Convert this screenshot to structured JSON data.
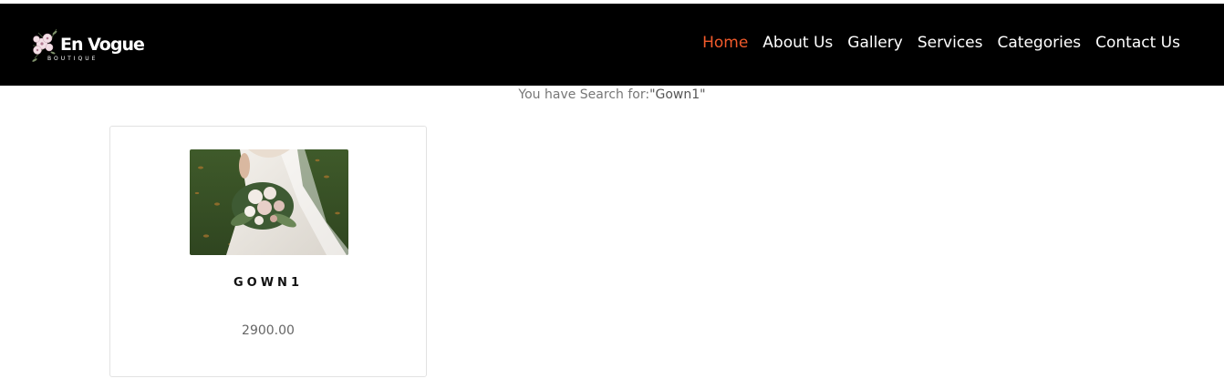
{
  "brand": {
    "name": "En Vogue",
    "tagline": "BOUTIQUE"
  },
  "nav": {
    "items": [
      {
        "label": "Home",
        "active": true
      },
      {
        "label": "About Us",
        "active": false
      },
      {
        "label": "Gallery",
        "active": false
      },
      {
        "label": "Services",
        "active": false
      },
      {
        "label": "Categories",
        "active": false
      },
      {
        "label": "Contact Us",
        "active": false
      }
    ]
  },
  "search": {
    "prefix": "You have Search for:",
    "query": "\"Gown1\""
  },
  "results": [
    {
      "title": "GOWN1",
      "price": "2900.00",
      "image": "bride-bouquet-photo"
    }
  ],
  "colors": {
    "navbar_bg": "#000000",
    "accent": "#f15a2b",
    "text_muted": "#777777"
  }
}
